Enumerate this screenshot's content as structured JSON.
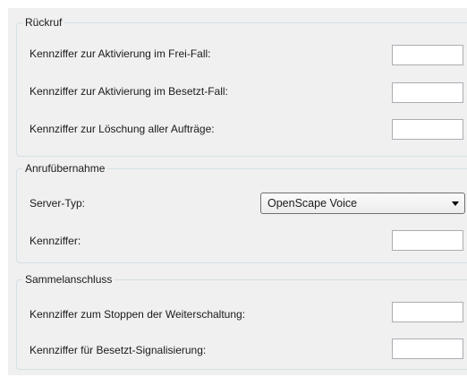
{
  "rueckruf": {
    "title": "Rückruf",
    "frei_fall_label": "Kennziffer zur Aktivierung im Frei-Fall:",
    "frei_fall_value": "",
    "besetzt_fall_label": "Kennziffer zur Aktivierung im Besetzt-Fall:",
    "besetzt_fall_value": "",
    "loeschung_label": "Kennziffer zur Löschung aller Aufträge:",
    "loeschung_value": ""
  },
  "anrufuebernahme": {
    "title": "Anrufübernahme",
    "server_typ_label": "Server-Typ:",
    "server_typ_value": "OpenScape Voice",
    "kennziffer_label": "Kennziffer:",
    "kennziffer_value": ""
  },
  "sammelanschluss": {
    "title": "Sammelanschluss",
    "stoppen_label": "Kennziffer zum Stoppen der Weiterschaltung:",
    "stoppen_value": "",
    "besetzt_signal_label": "Kennziffer für Besetzt-Signalisierung:",
    "besetzt_signal_value": ""
  }
}
